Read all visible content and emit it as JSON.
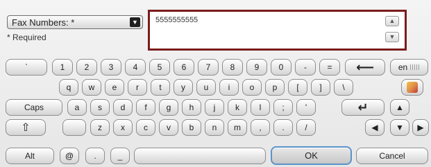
{
  "field": {
    "label": "Fax Numbers: *",
    "required_note": "* Required"
  },
  "input": {
    "value": "5555555555"
  },
  "keys": {
    "backtick": "`",
    "k1": "1",
    "k2": "2",
    "k3": "3",
    "k4": "4",
    "k5": "5",
    "k6": "6",
    "k7": "7",
    "k8": "8",
    "k9": "9",
    "k0": "0",
    "minus": "-",
    "equals": "=",
    "backspace": "⟵",
    "lang": "en",
    "q": "q",
    "w": "w",
    "e": "e",
    "r": "r",
    "t": "t",
    "y": "y",
    "u": "u",
    "i": "i",
    "o": "o",
    "p": "p",
    "lbracket": "[",
    "rbracket": "]",
    "backslash": "\\",
    "caps": "Caps",
    "a": "a",
    "s": "s",
    "d": "d",
    "f": "f",
    "g": "g",
    "h": "h",
    "j": "j",
    "k": "k",
    "l": "l",
    "semicolon": ";",
    "quote": "'",
    "enter": "↵",
    "up": "▲",
    "shift": "⇧",
    "z": "z",
    "x": "x",
    "c": "c",
    "v": "v",
    "b": "b",
    "n": "n",
    "m": "m",
    "comma": ",",
    "period": ".",
    "slash": "/",
    "left": "◀",
    "down": "▼",
    "right": "▶",
    "alt": "Alt",
    "at": "@",
    "dot": ".",
    "underscore": "_",
    "ok": "OK",
    "cancel": "Cancel"
  },
  "icons": {
    "dropdown": "chevron-down-icon",
    "scroll_up": "chevron-up-icon",
    "scroll_down": "chevron-down-icon",
    "pencil": "pencil-icon"
  },
  "colors": {
    "input_border": "#7b1c1c",
    "ok_border": "#5a93c9"
  }
}
